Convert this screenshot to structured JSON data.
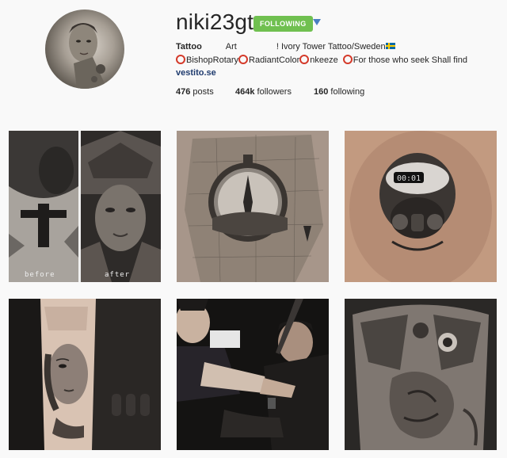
{
  "profile": {
    "username": "niki23gtr",
    "follow_state": "FOLLOWING",
    "bio_word1": "Tattoo",
    "bio_word2": "Art",
    "bio_word3": "! Ivory Tower Tattoo/Sweden",
    "bio_line2": {
      "item1": "BishopRotary",
      "item2": "RadiantColor",
      "item3": "nkeeze",
      "item4": "For those who seek Shall find"
    },
    "website": "vestito.se",
    "stats": {
      "posts_count": "476",
      "posts_label": "posts",
      "followers_count": "464k",
      "followers_label": "followers",
      "following_count": "160",
      "following_label": "following"
    }
  },
  "posts": {
    "tile1_before": "before",
    "tile1_after": "after"
  },
  "colors": {
    "follow_green": "#70c050",
    "caret_blue": "#4a7fc1",
    "ring_red": "#d43a2a",
    "link_navy": "#1f3b6e"
  }
}
